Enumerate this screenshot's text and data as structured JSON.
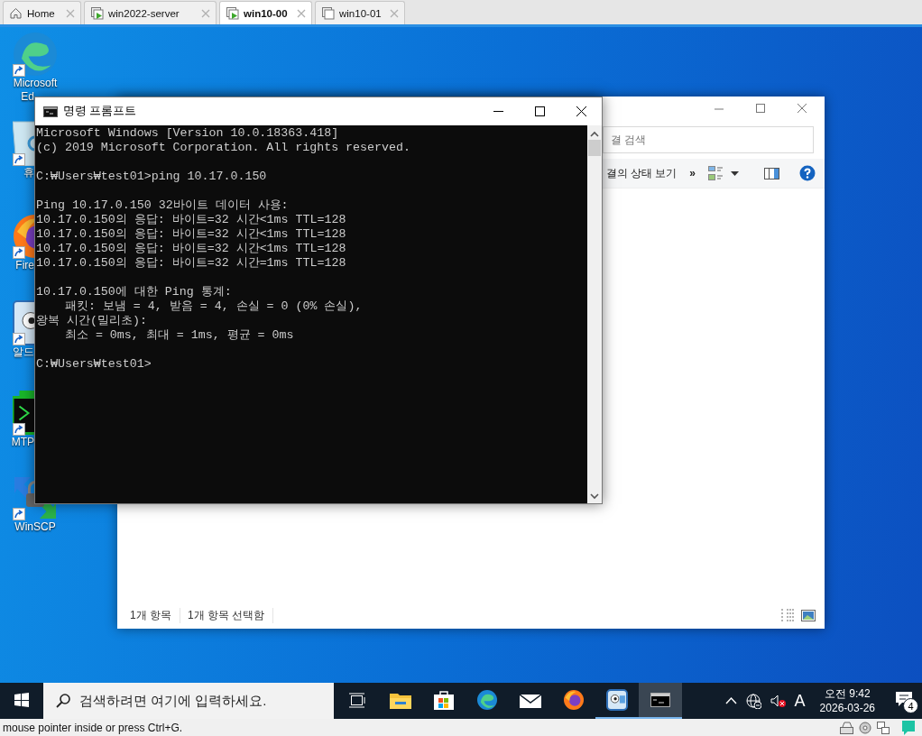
{
  "vm_tabs": [
    {
      "label": "Home",
      "kind": "home",
      "selected": false
    },
    {
      "label": "win2022-server",
      "kind": "vm-running",
      "selected": false
    },
    {
      "label": "win10-00",
      "kind": "vm-running",
      "selected": true
    },
    {
      "label": "win10-01",
      "kind": "vm-off",
      "selected": false
    }
  ],
  "desktop_icons": [
    {
      "kind": "edge",
      "label_lines": [
        {
          "text": "Microsoft",
          "cut": false
        },
        {
          "text": "Ed",
          "cut": true
        }
      ]
    },
    {
      "kind": "recycle-bin",
      "label_lines": [
        {
          "text": "휴",
          "cut": true
        }
      ]
    },
    {
      "kind": "firefox",
      "label_lines": [
        {
          "text": "Fire",
          "cut": true
        }
      ]
    },
    {
      "kind": "viewer",
      "label_lines": [
        {
          "text": "알드",
          "cut": true
        }
      ]
    },
    {
      "kind": "terminal",
      "label_lines": [
        {
          "text": "MTP",
          "cut": true
        }
      ]
    },
    {
      "kind": "winscp",
      "label_lines": [
        {
          "text": "WinSCP",
          "cut": false
        }
      ]
    }
  ],
  "explorer_window": {
    "search": {
      "placeholder": "결 검색"
    },
    "toolbar_text": "결의 상태 보기",
    "more": "»",
    "status_items": [
      "1개 항목",
      "1개 항목 선택함"
    ]
  },
  "cmd_window": {
    "title": "명령 프롬프트",
    "blocks": [
      [
        "Microsoft Windows [Version 10.0.18363.418]",
        "(c) 2019 Microsoft Corporation. All rights reserved."
      ],
      [
        "C:₩Users₩test01>ping 10.17.0.150"
      ],
      [
        "Ping 10.17.0.150 32바이트 데이터 사용:",
        "10.17.0.150의 응답: 바이트=32 시간<1ms TTL=128",
        "10.17.0.150의 응답: 바이트=32 시간<1ms TTL=128",
        "10.17.0.150의 응답: 바이트=32 시간<1ms TTL=128",
        "10.17.0.150의 응답: 바이트=32 시간=1ms TTL=128"
      ],
      [
        "10.17.0.150에 대한 Ping 통계:",
        "    패킷: 보냄 = 4, 받음 = 4, 손실 = 0 (0% 손실),",
        "왕복 시간(밀리초):",
        "    최소 = 0ms, 최대 = 1ms, 평균 = 0ms"
      ],
      [
        "C:₩Users₩test01>"
      ]
    ]
  },
  "taskbar": {
    "search": {
      "placeholder": "검색하려면 여기에 입력하세요."
    },
    "apps": [
      {
        "kind": "task-view",
        "running": false,
        "selected": false
      },
      {
        "kind": "folder",
        "running": false,
        "selected": false
      },
      {
        "kind": "store",
        "running": false,
        "selected": false
      },
      {
        "kind": "edge",
        "running": false,
        "selected": false
      },
      {
        "kind": "mail",
        "running": false,
        "selected": false
      },
      {
        "kind": "firefox",
        "running": false,
        "selected": false
      },
      {
        "kind": "viewer",
        "running": true,
        "selected": false
      },
      {
        "kind": "terminal",
        "running": true,
        "selected": true
      }
    ],
    "input_mode": "A",
    "time": "오전 9:42",
    "date": "2026-03-26",
    "notification_count": "4"
  },
  "status_strip": {
    "text": "mouse pointer inside or press Ctrl+G."
  }
}
